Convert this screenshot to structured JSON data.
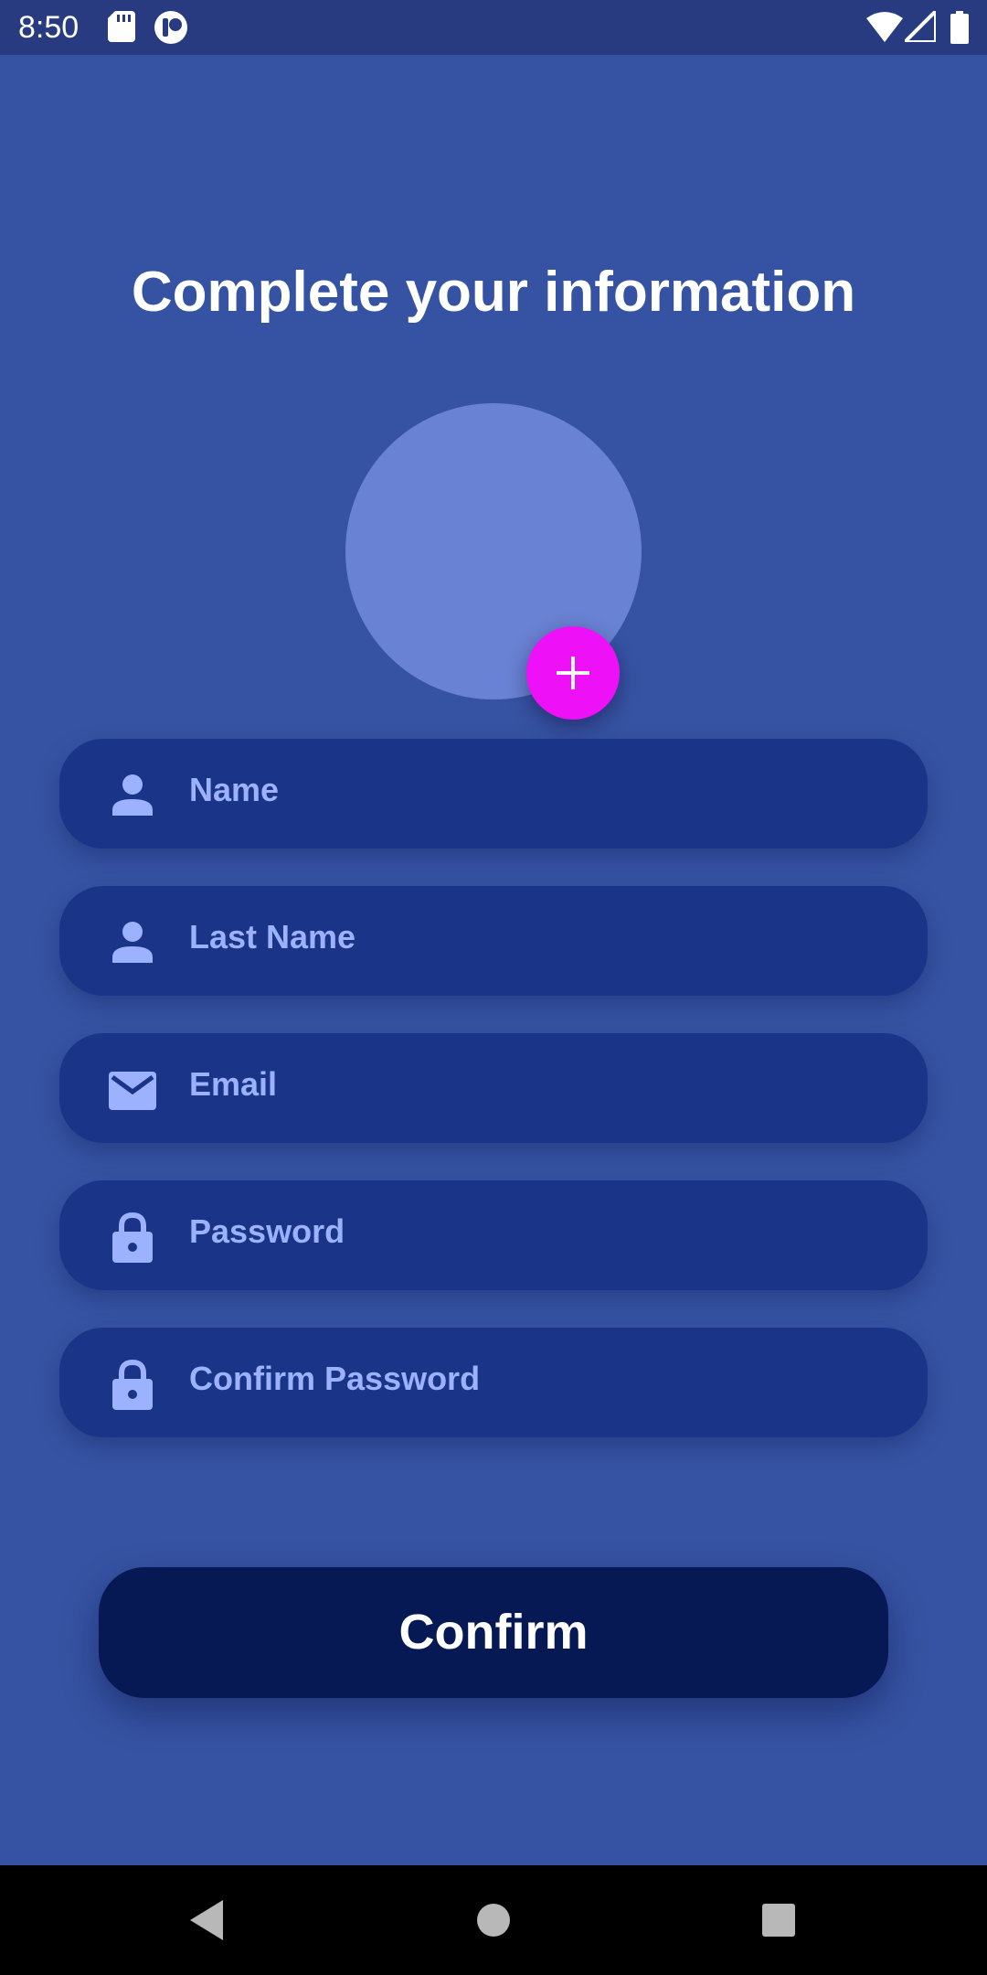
{
  "status_bar": {
    "time": "8:50",
    "left_icons": [
      "sd-card-icon",
      "app-notification-icon"
    ],
    "right_icons": [
      "wifi-icon",
      "cell-signal-icon",
      "battery-icon"
    ]
  },
  "main": {
    "title": "Complete your information",
    "avatar": {
      "add_button_icon": "plus-icon",
      "add_button_color": "#ee10f7"
    },
    "fields": [
      {
        "icon": "person-icon",
        "placeholder": "Name"
      },
      {
        "icon": "person-icon",
        "placeholder": "Last Name"
      },
      {
        "icon": "email-icon",
        "placeholder": "Email"
      },
      {
        "icon": "lock-icon",
        "placeholder": "Password"
      },
      {
        "icon": "lock-icon",
        "placeholder": "Confirm Password"
      }
    ],
    "confirm_label": "Confirm"
  },
  "nav_bar": {
    "buttons": [
      "back-icon",
      "home-icon",
      "recents-icon"
    ]
  },
  "colors": {
    "background": "#3653a3",
    "status_bar": "#293b80",
    "field_background": "#1a3587",
    "field_text": "#9cb2ff",
    "avatar": "#6a82d3",
    "confirm_button": "#061955"
  }
}
